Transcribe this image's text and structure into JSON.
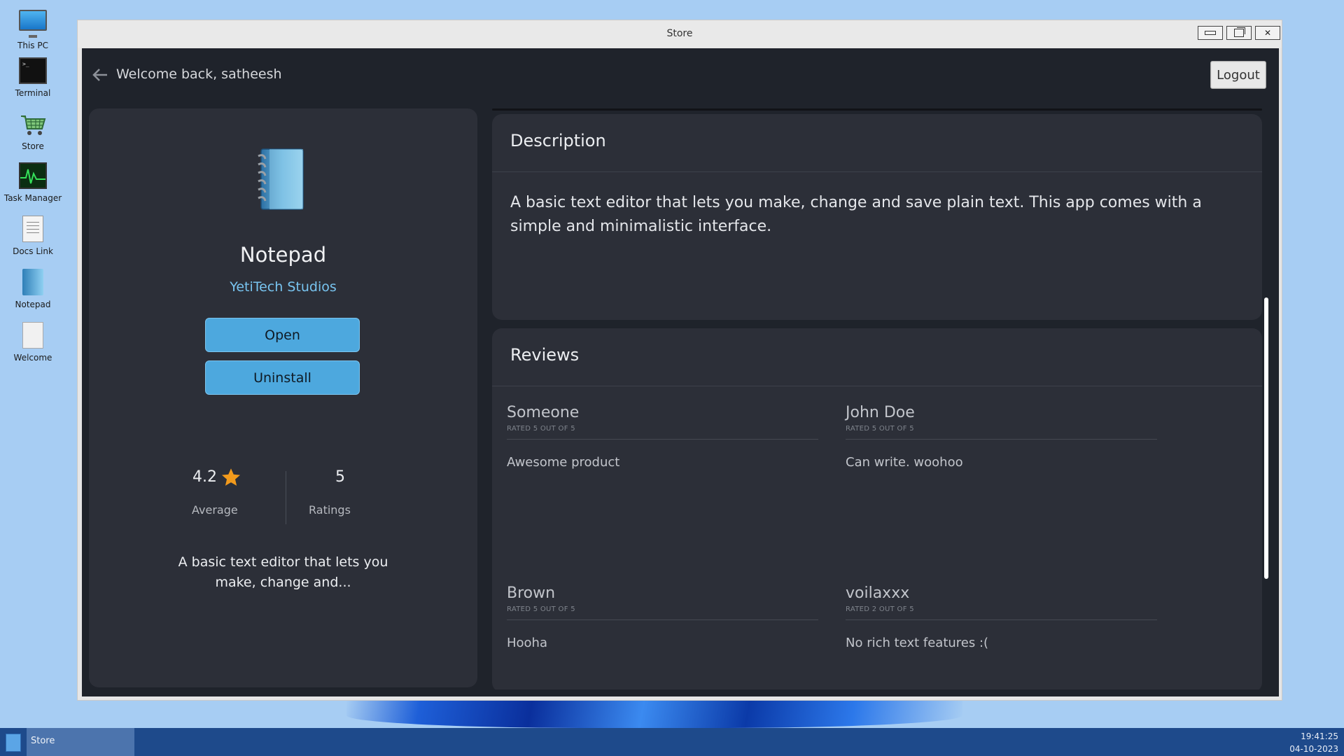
{
  "desktop": {
    "icons": [
      {
        "label": "This PC",
        "icon": "computer-icon"
      },
      {
        "label": "Terminal",
        "icon": "terminal-icon"
      },
      {
        "label": "Store",
        "icon": "store-cart-icon"
      },
      {
        "label": "Task Manager",
        "icon": "task-manager-icon"
      },
      {
        "label": "Docs Link",
        "icon": "document-icon"
      },
      {
        "label": "Notepad",
        "icon": "notepad-icon"
      },
      {
        "label": "Welcome",
        "icon": "document-icon"
      }
    ]
  },
  "window": {
    "title": "Store",
    "controls": {
      "minimize": "—",
      "maximize": "⧉",
      "close": "✕"
    }
  },
  "header": {
    "welcome": "Welcome back, satheesh",
    "logout_label": "Logout"
  },
  "app": {
    "name": "Notepad",
    "developer": "YetiTech Studios",
    "open_label": "Open",
    "uninstall_label": "Uninstall",
    "rating_average": "4.2",
    "rating_average_label": "Average",
    "rating_count": "5",
    "rating_count_label": "Ratings",
    "short_description": "A basic text editor that lets you make, change and...",
    "accent_color": "#4da8de",
    "star_color": "#f29a1c"
  },
  "description": {
    "title": "Description",
    "text": "A basic text editor that lets you make, change and save plain text. This app comes with a simple and minimalistic interface."
  },
  "reviews": {
    "title": "Reviews",
    "items": [
      {
        "name": "Someone",
        "rating": "RATED 5 OUT OF 5",
        "text": "Awesome product"
      },
      {
        "name": "John Doe",
        "rating": "RATED 5 OUT OF 5",
        "text": "Can write. woohoo"
      },
      {
        "name": "Brown",
        "rating": "RATED 5 OUT OF 5",
        "text": "Hooha"
      },
      {
        "name": "voilaxxx",
        "rating": "RATED 2 OUT OF 5",
        "text": "No rich text features :("
      }
    ]
  },
  "taskbar": {
    "active_app": "Store",
    "time": "19:41:25",
    "date": "04-10-2023"
  }
}
